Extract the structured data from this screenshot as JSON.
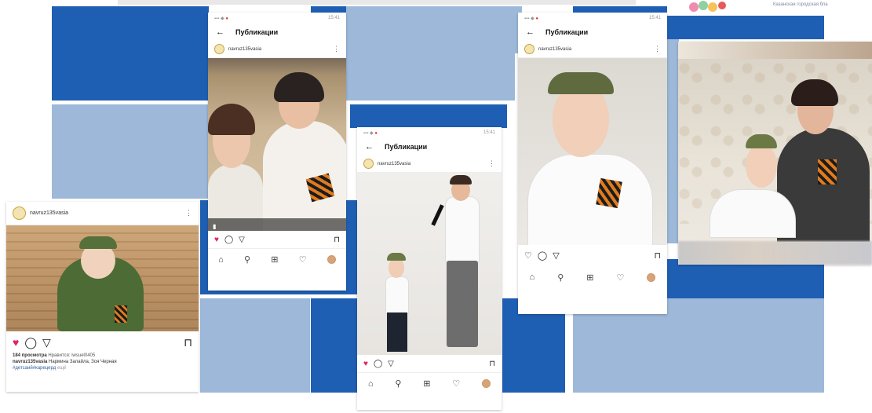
{
  "slide": {
    "header_text": "",
    "logo_caption": "Казанская городская бла"
  },
  "colors": {
    "tile_dark": "#1f5fb3",
    "tile_light": "#9db8d8",
    "heart": "#e0245e",
    "ribbon_orange": "#e07b1e",
    "ribbon_black": "#1c1c1c"
  },
  "post1": {
    "username": "navruz135vasia",
    "views": "184 просмотра",
    "liked_by": "Нравится: iwsuel0405",
    "caption_user": "navruz135vasia",
    "caption_text": "Нармина Залайла, Зоя Черная",
    "hashtags": "#детсаий#карецерд",
    "more": "ещё",
    "icons": {
      "like": "heart-filled-icon",
      "comment": "comment-icon",
      "share": "send-icon",
      "save": "bookmark-icon"
    }
  },
  "post2": {
    "nav_title": "Публикации",
    "username": "navruz135vasia",
    "status_time": "15:41"
  },
  "post3": {
    "nav_title": "Публикации",
    "username": "navruz135vasia",
    "status_time": "15:41"
  },
  "post4": {
    "nav_title": "Публикации",
    "username": "navruz135vasia",
    "status_time": "15:41"
  }
}
